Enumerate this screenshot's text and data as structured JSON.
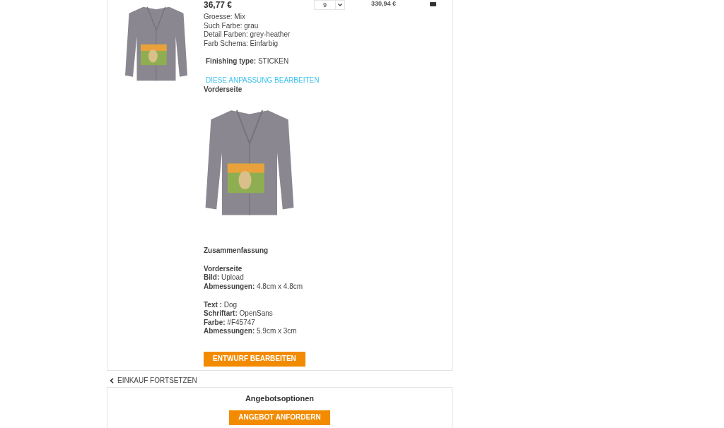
{
  "cart_item": {
    "price": "36,77 €",
    "quantity": "9",
    "total": "330,94 €",
    "attributes": [
      "Groesse: Mix",
      "Such Farbe: grau",
      "Detail Farben: grey-heather",
      "Farb Schema: Einfarbig"
    ],
    "finishing": {
      "label": "Finishing type:",
      "value": "STICKEN"
    },
    "edit_link": "DIESE ANPASSUNG BEARBEITEN",
    "side_label": "Vorderseite"
  },
  "summary": {
    "title": "Zusammenfassung",
    "sections": [
      {
        "title": "Vorderseite",
        "lines": [
          {
            "label": "Bild:",
            "value": "Upload"
          },
          {
            "label": "Abmessungen:",
            "value": "4.8cm x 4.8cm"
          }
        ]
      },
      {
        "lines": [
          {
            "label": "Text :",
            "value": "Dog"
          },
          {
            "label": "Schriftart:",
            "value": "OpenSans"
          },
          {
            "label": "Farbe:",
            "value": "#F45747"
          },
          {
            "label": "Abmessungen:",
            "value": "5.9cm x 3cm"
          }
        ]
      }
    ],
    "button": "ENTWURF BEARBEITEN"
  },
  "continue_link": "EINKAUF FORTSETZEN",
  "quote_options": {
    "title": "Angebotsoptionen",
    "button": "ANGEBOT ANFORDERN"
  }
}
